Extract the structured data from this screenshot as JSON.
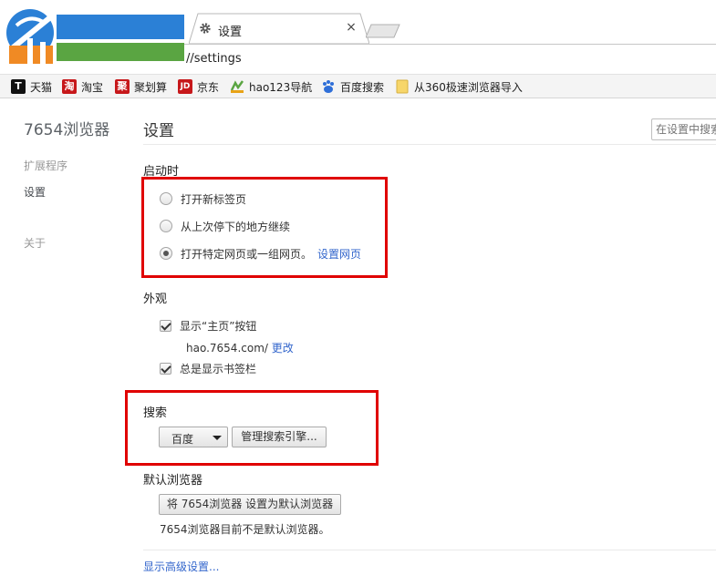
{
  "browser": {
    "tab": {
      "title": "设置",
      "icon": "gear-icon",
      "close_glyph": "×"
    },
    "address": {
      "url": "//settings"
    },
    "bookmarks": [
      {
        "label": "天猫",
        "icon": "tmall-icon",
        "glyph": "T",
        "color": "#d40000"
      },
      {
        "label": "淘宝",
        "icon": "taobao-icon",
        "glyph": "淘",
        "color": "#c7181b"
      },
      {
        "label": "聚划算",
        "icon": "juhuasuan-icon",
        "glyph": "聚",
        "color": "#c7181b"
      },
      {
        "label": "京东",
        "icon": "jd-icon",
        "glyph": "JD",
        "color": "#c7181b"
      },
      {
        "label": "hao123导航",
        "icon": "hao123-icon",
        "glyph": "",
        "color": "#5aa542"
      },
      {
        "label": "百度搜索",
        "icon": "baidu-paw-icon",
        "glyph": "",
        "color": "#2f6fd8"
      },
      {
        "label": "从360极速浏览器导入",
        "icon": "folder-icon",
        "glyph": "",
        "color": "#f2c94c"
      }
    ]
  },
  "sidebar": {
    "title": "7654浏览器",
    "items": [
      {
        "label": "扩展程序",
        "active": false
      },
      {
        "label": "设置",
        "active": true
      },
      {
        "label": "关于",
        "active": false
      }
    ]
  },
  "main": {
    "title": "设置",
    "search_placeholder": "在设置中搜索",
    "startup": {
      "heading": "启动时",
      "options": [
        {
          "label": "打开新标签页",
          "selected": false
        },
        {
          "label": "从上次停下的地方继续",
          "selected": false
        },
        {
          "label": "打开特定网页或一组网页。",
          "selected": true,
          "link": "设置网页"
        }
      ]
    },
    "appearance": {
      "heading": "外观",
      "show_home_label": "显示“主页”按钮",
      "show_home_checked": true,
      "home_url": "hao.7654.com/",
      "home_change_link": "更改",
      "show_bookmarks_label": "总是显示书签栏",
      "show_bookmarks_checked": true
    },
    "search": {
      "heading": "搜索",
      "engine_selected": "百度",
      "manage_button": "管理搜索引擎..."
    },
    "default_browser": {
      "heading": "默认浏览器",
      "set_default_button": "将 7654浏览器 设置为默认浏览器",
      "status": "7654浏览器目前不是默认浏览器。"
    },
    "advanced_link": "显示高级设置..."
  },
  "colors": {
    "highlight_box": "#e00000",
    "link": "#3366cc",
    "logo_blue": "#2b80d6",
    "logo_green": "#5aa542"
  }
}
